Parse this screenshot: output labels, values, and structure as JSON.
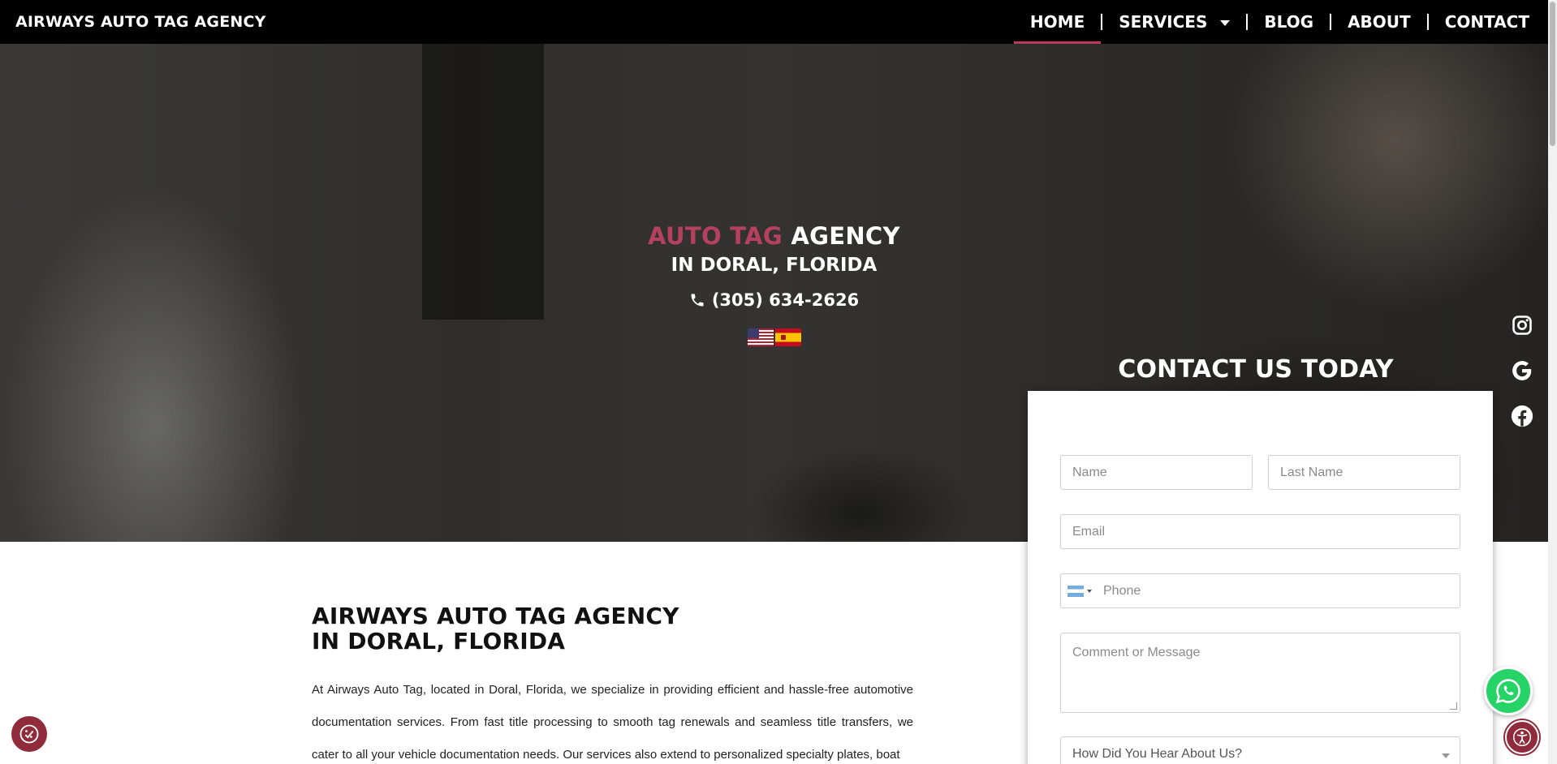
{
  "header": {
    "brand": "AIRWAYS AUTO TAG AGENCY",
    "nav": {
      "home": "HOME",
      "services": "SERVICES",
      "blog": "BLOG",
      "about": "ABOUT",
      "contact": "CONTACT"
    },
    "active_item": "HOME"
  },
  "hero": {
    "title_accent": "AUTO TAG",
    "title_rest": "AGENCY",
    "subtitle": "IN DORAL, FLORIDA",
    "phone": "(305) 634-2626",
    "languages": [
      "English",
      "Español"
    ]
  },
  "social": {
    "icons": [
      "instagram-icon",
      "google-icon",
      "facebook-icon"
    ]
  },
  "contact": {
    "title": "CONTACT US TODAY",
    "name_placeholder": "Name",
    "last_name_placeholder": "Last Name",
    "email_placeholder": "Email",
    "phone_placeholder": "Phone",
    "message_placeholder": "Comment or Message",
    "source_select": "How Did You Hear About Us?"
  },
  "content": {
    "heading_line1": "AIRWAYS AUTO TAG AGENCY",
    "heading_line2": "IN DORAL, FLORIDA",
    "paragraph": "At Airways Auto Tag, located in Doral, Florida, we specialize in providing efficient and hassle-free automotive documentation services. From fast title processing to smooth tag renewals and seamless title transfers, we cater to all your vehicle documentation needs. Our services also extend to personalized specialty plates, boat"
  },
  "colors": {
    "accent": "#b5405f",
    "nav_underline": "#c0395a",
    "header_bg": "#000000",
    "whatsapp": "#25d366",
    "widget": "#8f2b3a"
  },
  "widgets": {
    "cookie": "cookie-consent-icon",
    "whatsapp": "whatsapp-icon",
    "accessibility": "accessibility-icon"
  }
}
